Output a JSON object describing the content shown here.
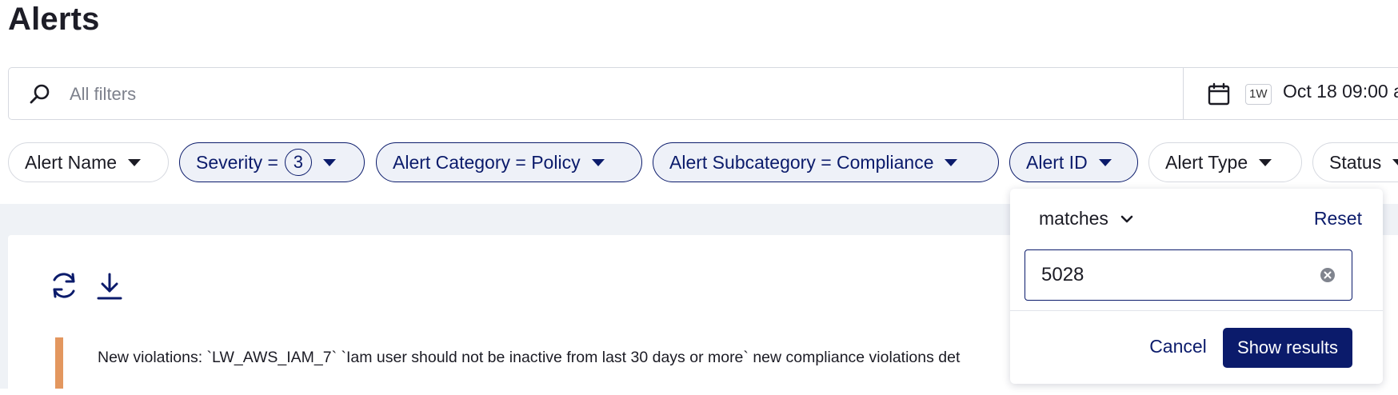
{
  "page": {
    "title": "Alerts"
  },
  "search": {
    "placeholder": "All filters",
    "value": "",
    "icon": "search-icon"
  },
  "date_range": {
    "icon": "calendar-icon",
    "range_badge": "1W",
    "text": "Oct 18 09:00 a"
  },
  "filters": [
    {
      "label": "Alert Name",
      "active": false
    },
    {
      "label": "Severity =",
      "count": "3",
      "active": true
    },
    {
      "label": "Alert Category = Policy",
      "active": true
    },
    {
      "label": "Alert Subcategory = Compliance",
      "active": true
    },
    {
      "label": "Alert ID",
      "active": true,
      "open": true
    },
    {
      "label": "Alert Type",
      "active": false
    },
    {
      "label": "Status",
      "active": false
    }
  ],
  "toolbar": {
    "refresh_icon": "refresh-icon",
    "download_icon": "download-icon"
  },
  "alerts": [
    {
      "severity_color": "#e3975f",
      "text": "New violations: `LW_AWS_IAM_7` `Iam user should not be inactive from last 30 days or more` new compliance violations det"
    }
  ],
  "alert_id_dropdown": {
    "operator": "matches",
    "reset_label": "Reset",
    "value": "5028",
    "cancel_label": "Cancel",
    "submit_label": "Show results"
  },
  "colors": {
    "accent": "#0b1b6b",
    "active_chip_bg": "#eef1f8",
    "content_bg": "#eff2f6",
    "severity_medium": "#e3975f"
  }
}
